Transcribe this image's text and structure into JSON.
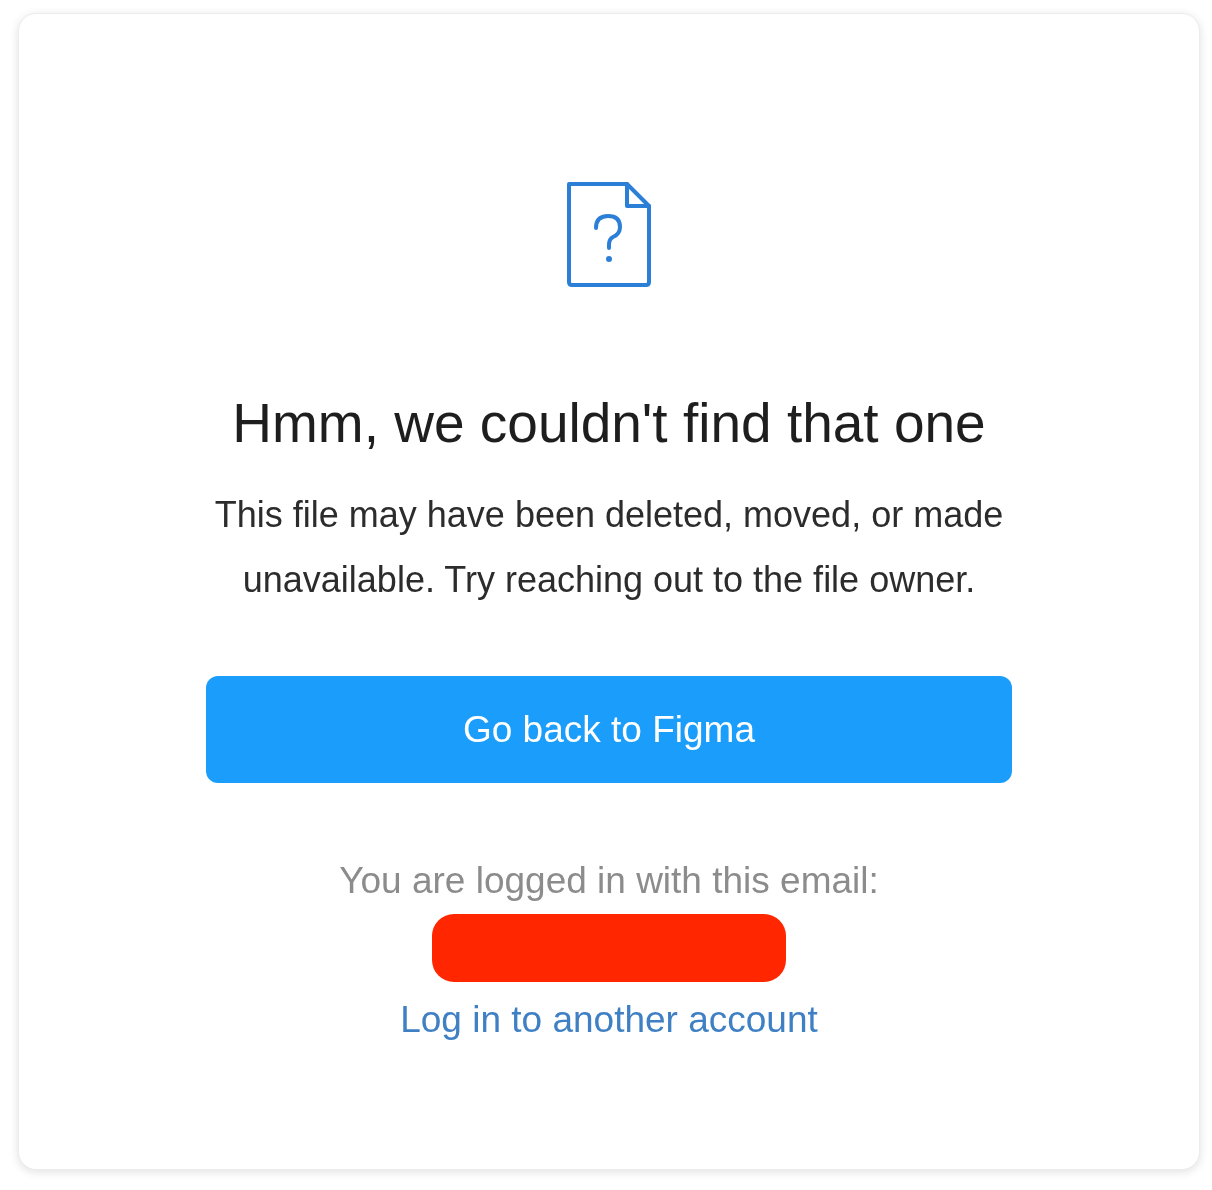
{
  "heading": "Hmm, we couldn't find that one",
  "message": "This file may have been deleted, moved, or made unavailable. Try reaching out to the file owner.",
  "primary_button": {
    "label": "Go back to Figma"
  },
  "account": {
    "label": "You are logged in with this email:",
    "email_redacted": true,
    "link": "Log in to another account"
  }
}
